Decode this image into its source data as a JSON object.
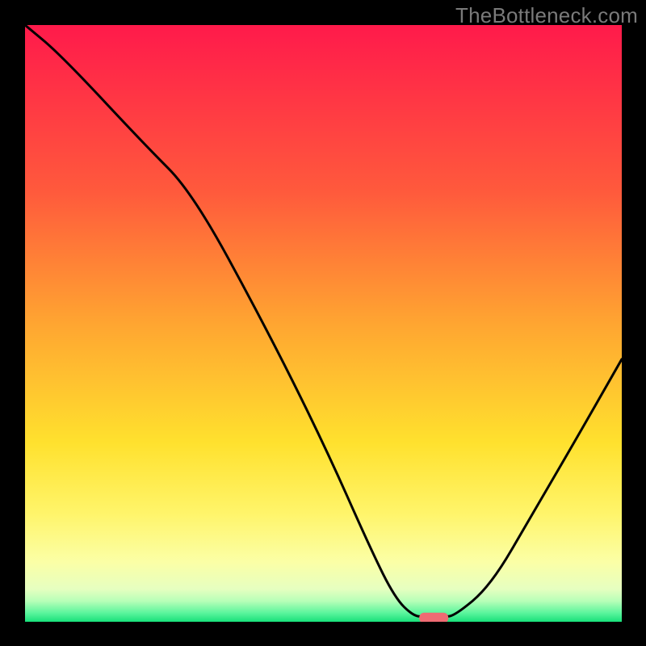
{
  "watermark": "TheBottleneck.com",
  "chart_data": {
    "type": "line",
    "title": "",
    "xlabel": "",
    "ylabel": "",
    "xlim": [
      0,
      100
    ],
    "ylim": [
      0,
      100
    ],
    "series": [
      {
        "name": "curve",
        "x": [
          0,
          6,
          20,
          28,
          40,
          50,
          58,
          62,
          65,
          67,
          70,
          72,
          78,
          85,
          92,
          100
        ],
        "values": [
          100,
          95,
          80,
          72,
          50,
          30,
          12,
          4,
          1,
          0.8,
          0.8,
          1,
          6,
          18,
          30,
          44
        ]
      }
    ],
    "marker": {
      "x": 68.5,
      "y": 0.7
    },
    "gradient_stops": [
      {
        "offset": 0,
        "color": "#ff1a4b"
      },
      {
        "offset": 0.28,
        "color": "#ff5a3c"
      },
      {
        "offset": 0.5,
        "color": "#ffa531"
      },
      {
        "offset": 0.7,
        "color": "#ffe12e"
      },
      {
        "offset": 0.82,
        "color": "#fff56b"
      },
      {
        "offset": 0.9,
        "color": "#fbffa6"
      },
      {
        "offset": 0.945,
        "color": "#e6ffc0"
      },
      {
        "offset": 0.965,
        "color": "#b8ffb8"
      },
      {
        "offset": 0.985,
        "color": "#5cf59d"
      },
      {
        "offset": 1.0,
        "color": "#18e07a"
      }
    ]
  }
}
